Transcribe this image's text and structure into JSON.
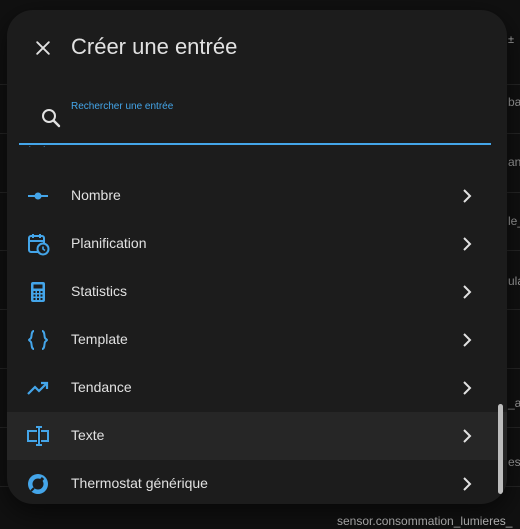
{
  "dialog": {
    "title": "Créer une entrée",
    "search": {
      "label": "Rechercher une entrée",
      "value": "",
      "placeholder": ""
    },
    "items": [
      {
        "label": "Nombre",
        "icon": "ray-vertex-icon"
      },
      {
        "label": "Planification",
        "icon": "calendar-clock-icon"
      },
      {
        "label": "Statistics",
        "icon": "calculator-icon"
      },
      {
        "label": "Template",
        "icon": "code-braces-icon"
      },
      {
        "label": "Tendance",
        "icon": "trending-up-icon"
      },
      {
        "label": "Texte",
        "icon": "form-textbox-icon"
      },
      {
        "label": "Thermostat générique",
        "icon": "thermostat-icon"
      }
    ]
  },
  "background": {
    "fragments": [
      "ba",
      "an",
      "le_",
      "ula",
      "_au",
      "es_"
    ],
    "bottom_text": "sensor.consommation_lumieres_",
    "top_right": "±"
  },
  "colors": {
    "accent": "#44a5e9",
    "icon": "#44a5e9",
    "surface": "#1c1c1c",
    "text": "#e1e1e1"
  }
}
